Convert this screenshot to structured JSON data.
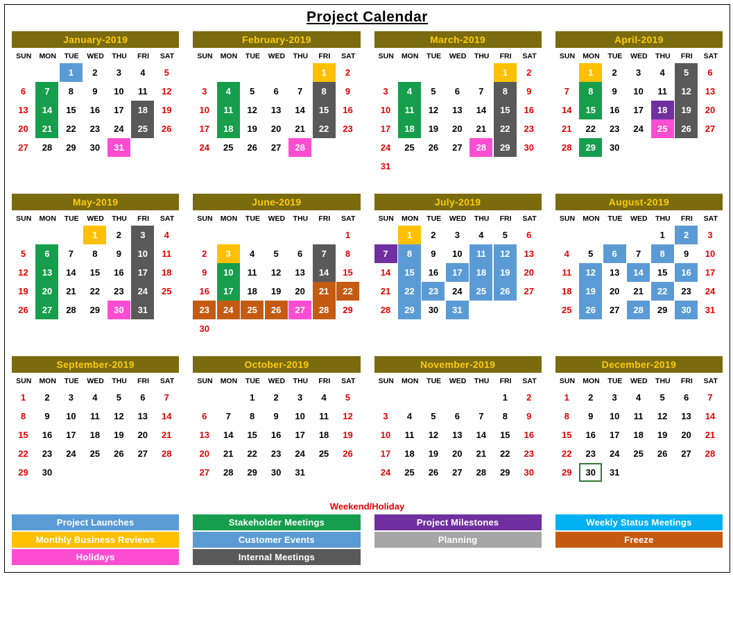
{
  "title": "Project Calendar",
  "dow": [
    "SUN",
    "MON",
    "TUE",
    "WED",
    "THU",
    "FRI",
    "SAT"
  ],
  "legend_weekend": "Weekend/Holiday",
  "legend_cols": [
    [
      {
        "label": "Project Launches",
        "cls": "c-launch"
      },
      {
        "label": "Monthly Business Reviews",
        "cls": "c-mbr"
      },
      {
        "label": "Holidays",
        "cls": "c-hol"
      }
    ],
    [
      {
        "label": "Stakeholder Meetings",
        "cls": "c-stake"
      },
      {
        "label": "Customer Events",
        "cls": "c-cust"
      },
      {
        "label": "Internal Meetings",
        "cls": "c-int"
      }
    ],
    [
      {
        "label": "Project Milestones",
        "cls": "c-mile"
      },
      {
        "label": "Planning",
        "cls": "c-plan"
      }
    ],
    [
      {
        "label": "Weekly Status Meetings",
        "cls": "c-status"
      },
      {
        "label": "Freeze",
        "cls": "c-freeze"
      }
    ]
  ],
  "months": [
    {
      "name": "January-2019",
      "startDow": 2,
      "days": 31,
      "events": {
        "1": "c-launch",
        "7": "c-stake",
        "14": "c-stake",
        "18": "c-int",
        "21": "c-stake",
        "25": "c-int",
        "31": "c-hol"
      }
    },
    {
      "name": "February-2019",
      "startDow": 5,
      "days": 28,
      "events": {
        "1": "c-mbr",
        "4": "c-stake",
        "8": "c-int",
        "11": "c-stake",
        "15": "c-int",
        "18": "c-stake",
        "22": "c-int",
        "28": "c-hol"
      }
    },
    {
      "name": "March-2019",
      "startDow": 5,
      "days": 31,
      "events": {
        "1": "c-mbr",
        "4": "c-stake",
        "8": "c-int",
        "11": "c-stake",
        "15": "c-int",
        "18": "c-stake",
        "22": "c-int",
        "28": "c-hol",
        "29": "c-int"
      }
    },
    {
      "name": "April-2019",
      "startDow": 1,
      "days": 30,
      "events": {
        "1": "c-mbr",
        "5": "c-int",
        "8": "c-stake",
        "12": "c-int",
        "15": "c-stake",
        "18": "c-mile",
        "19": "c-int",
        "25": "c-hol",
        "26": "c-int",
        "29": "c-stake"
      }
    },
    {
      "name": "May-2019",
      "startDow": 3,
      "days": 31,
      "events": {
        "1": "c-mbr",
        "3": "c-int",
        "6": "c-stake",
        "10": "c-int",
        "13": "c-stake",
        "17": "c-int",
        "20": "c-stake",
        "24": "c-int",
        "27": "c-stake",
        "30": "c-hol",
        "31": "c-int"
      }
    },
    {
      "name": "June-2019",
      "startDow": 6,
      "days": 30,
      "events": {
        "3": "c-mbr",
        "7": "c-int",
        "10": "c-stake",
        "14": "c-int",
        "17": "c-stake",
        "21": "c-freeze",
        "22": "c-freeze",
        "23": "c-freeze",
        "24": "c-freeze",
        "25": "c-freeze",
        "26": "c-freeze",
        "27": "c-hol",
        "28": "c-freeze"
      }
    },
    {
      "name": "July-2019",
      "startDow": 1,
      "days": 31,
      "events": {
        "1": "c-mbr",
        "7": "c-mile",
        "8": "c-launch",
        "11": "c-launch",
        "12": "c-launch",
        "15": "c-launch",
        "17": "c-launch",
        "18": "c-launch",
        "19": "c-launch",
        "22": "c-launch",
        "23": "c-launch",
        "25": "c-launch",
        "26": "c-launch",
        "29": "c-launch",
        "31": "c-launch"
      }
    },
    {
      "name": "August-2019",
      "startDow": 4,
      "days": 31,
      "events": {
        "2": "c-launch",
        "6": "c-launch",
        "8": "c-launch",
        "12": "c-launch",
        "14": "c-launch",
        "16": "c-launch",
        "19": "c-launch",
        "22": "c-launch",
        "26": "c-launch",
        "28": "c-launch",
        "30": "c-launch"
      }
    },
    {
      "name": "September-2019",
      "startDow": 0,
      "days": 30,
      "events": {}
    },
    {
      "name": "October-2019",
      "startDow": 2,
      "days": 31,
      "events": {}
    },
    {
      "name": "November-2019",
      "startDow": 5,
      "days": 30,
      "events": {}
    },
    {
      "name": "December-2019",
      "startDow": 0,
      "days": 31,
      "events": {
        "30": "sel"
      }
    }
  ]
}
